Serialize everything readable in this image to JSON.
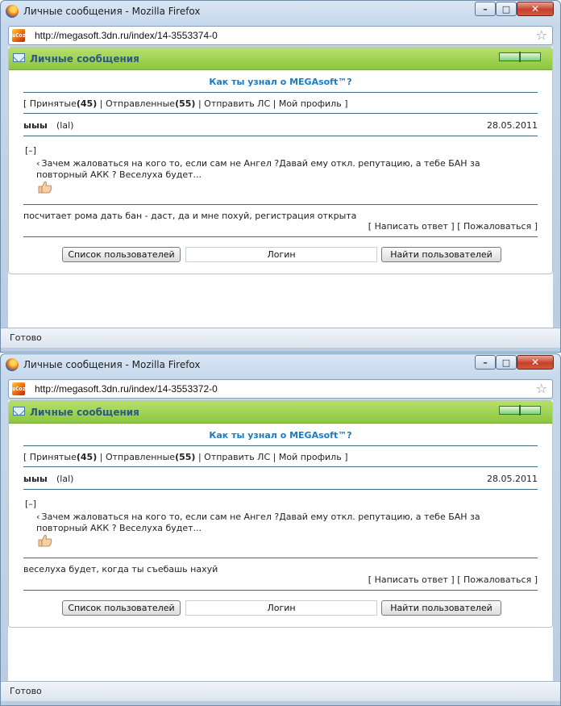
{
  "windows": [
    {
      "title": "Личные сообщения - Mozilla Firefox",
      "url": "http://megasoft.3dn.ru/index/14-3553374-0",
      "panel_title": "Личные сообщения",
      "topic": "Как ты узнал о MEGAsoft™?",
      "nav": {
        "open_bracket": "[",
        "inbox_label": "Принятые",
        "inbox_count": "(45)",
        "sep1": "|",
        "sent_label": "Отправленные",
        "sent_count": "(55)",
        "sep2": "|",
        "send_label": "Отправить ЛС",
        "sep3": "|",
        "profile_label": "Мой профиль",
        "close_bracket": "]"
      },
      "sender": "ыыы",
      "sender_login": "(lal)",
      "date": "28.05.2011",
      "toggle": "[–]",
      "quote": "Зачем жаловаться на кого то, если сам не Ангел ?Давай ему откл. репутацию, а тебе БАН за повторный АКК ? Веселуха будет...",
      "message": "посчитает рома дать бан - даст, да и мне похуй, регистрация открыта",
      "actions": {
        "open1": "[",
        "reply": "Написать ответ",
        "mid": "] [",
        "report": "Пожаловаться",
        "close2": "]"
      },
      "buttons": {
        "user_list": "Список пользователей",
        "login_value": "Логин",
        "find_users": "Найти пользователей"
      },
      "status": "Готово"
    },
    {
      "title": "Личные сообщения - Mozilla Firefox",
      "url": "http://megasoft.3dn.ru/index/14-3553372-0",
      "panel_title": "Личные сообщения",
      "topic": "Как ты узнал о MEGAsoft™?",
      "nav": {
        "open_bracket": "[",
        "inbox_label": "Принятые",
        "inbox_count": "(45)",
        "sep1": "|",
        "sent_label": "Отправленные",
        "sent_count": "(55)",
        "sep2": "|",
        "send_label": "Отправить ЛС",
        "sep3": "|",
        "profile_label": "Мой профиль",
        "close_bracket": "]"
      },
      "sender": "ыыы",
      "sender_login": "(lal)",
      "date": "28.05.2011",
      "toggle": "[–]",
      "quote": "Зачем жаловаться на кого то, если сам не Ангел ?Давай ему откл. репутацию, а тебе БАН за повторный АКК ? Веселуха будет...",
      "message": "веселуха будет, когда ты съебашь нахуй",
      "actions": {
        "open1": "[",
        "reply": "Написать ответ",
        "mid": "] [",
        "report": "Пожаловаться",
        "close2": "]"
      },
      "buttons": {
        "user_list": "Список пользователей",
        "login_value": "Логин",
        "find_users": "Найти пользователей"
      },
      "status": "Готово"
    }
  ],
  "icons": {
    "window_controls": {
      "minimize": "–",
      "maximize": "□",
      "close": "✕"
    },
    "site_favicon": "uCoz",
    "bookmark_star": "☆",
    "quote_arrow": "‹"
  },
  "colors": {
    "panel_header": "#8cc63f",
    "topic_link": "#1a7bc4",
    "panel_title_text": "#2a5a84",
    "divider": "#3e6a84"
  }
}
